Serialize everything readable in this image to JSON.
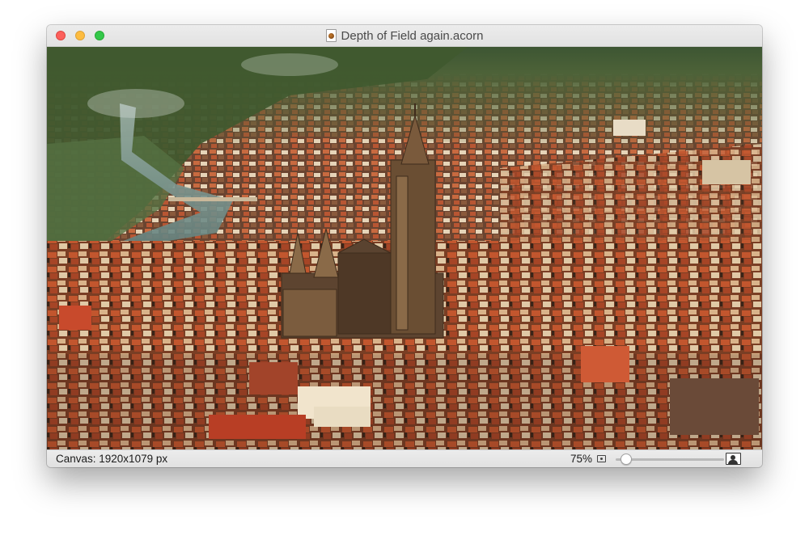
{
  "window": {
    "title": "Depth of Field again.acorn",
    "file_icon": "acorn-document-icon"
  },
  "canvas": {
    "image_description_icon": "photo-aerial-city"
  },
  "statusbar": {
    "canvas_size": "Canvas: 1920x1079 px",
    "zoom_label": "75%",
    "zoom_level": 0.05,
    "small_icon": "image-small-icon",
    "large_icon": "image-large-icon"
  }
}
